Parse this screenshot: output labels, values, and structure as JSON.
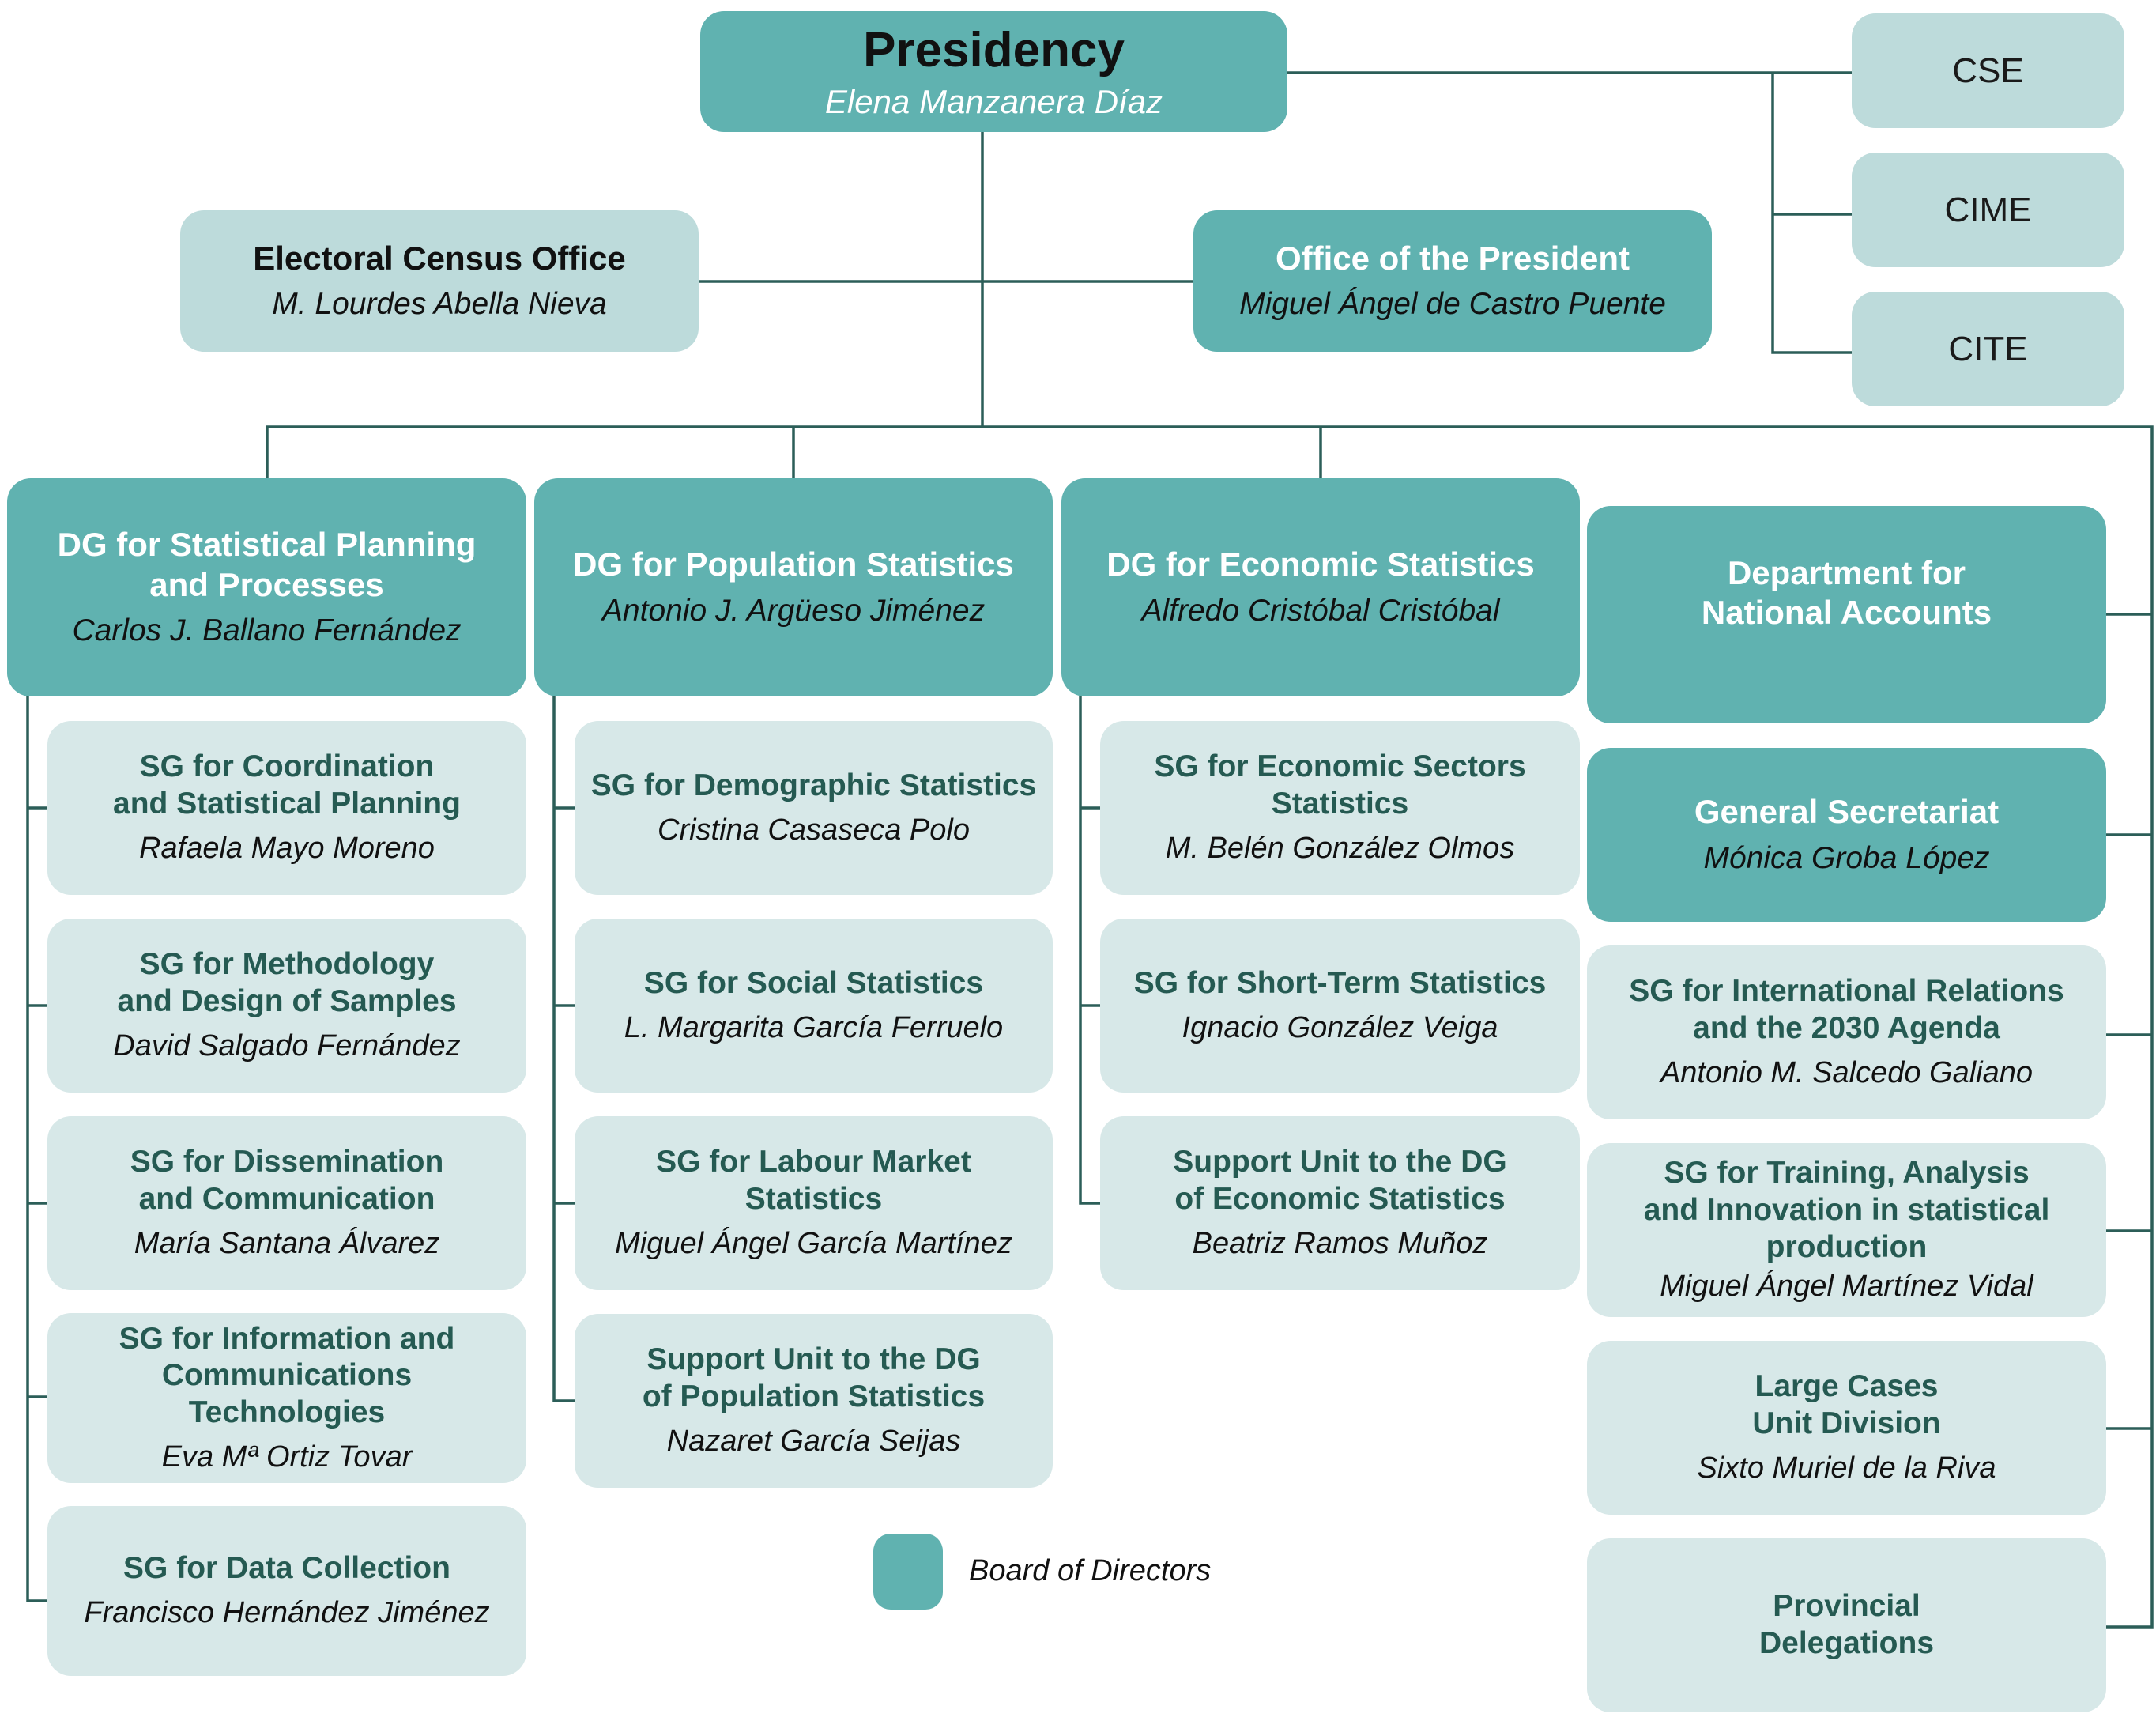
{
  "presidency": {
    "title": "Presidency",
    "name": "Elena Manzanera Díaz"
  },
  "councils": [
    {
      "label": "CSE"
    },
    {
      "label": "CIME"
    },
    {
      "label": "CITE"
    }
  ],
  "electoral_census_office": {
    "title": "Electoral Census Office",
    "name": "M. Lourdes Abella Nieva"
  },
  "office_of_president": {
    "title": "Office of the President",
    "name": "Miguel Ángel de Castro Puente"
  },
  "directorates": [
    {
      "title_lines": [
        "DG for Statistical Planning",
        "and Processes"
      ],
      "name": "Carlos J. Ballano Fernández",
      "units": [
        {
          "title_lines": [
            "SG for Coordination",
            "and Statistical Planning"
          ],
          "name": "Rafaela Mayo Moreno"
        },
        {
          "title_lines": [
            "SG for Methodology",
            "and Design of Samples"
          ],
          "name": "David Salgado Fernández"
        },
        {
          "title_lines": [
            "SG for Dissemination",
            "and Communication"
          ],
          "name": "María Santana Álvarez"
        },
        {
          "title_lines": [
            "SG for Information and",
            "Communications Technologies"
          ],
          "name": "Eva Mª Ortiz Tovar"
        },
        {
          "title_lines": [
            "SG for Data Collection"
          ],
          "name": "Francisco Hernández Jiménez"
        }
      ]
    },
    {
      "title_lines": [
        "DG for Population Statistics"
      ],
      "name": "Antonio J. Argüeso Jiménez",
      "units": [
        {
          "title_lines": [
            "SG for Demographic Statistics"
          ],
          "name": "Cristina Casaseca Polo"
        },
        {
          "title_lines": [
            "SG for Social Statistics"
          ],
          "name": "L. Margarita García Ferruelo"
        },
        {
          "title_lines": [
            "SG for Labour Market",
            "Statistics"
          ],
          "name": "Miguel Ángel García Martínez"
        },
        {
          "title_lines": [
            "Support Unit to the DG",
            "of Population Statistics"
          ],
          "name": "Nazaret García Seijas"
        }
      ]
    },
    {
      "title_lines": [
        "DG for Economic Statistics"
      ],
      "name": "Alfredo Cristóbal Cristóbal",
      "units": [
        {
          "title_lines": [
            "SG for Economic Sectors",
            "Statistics"
          ],
          "name": "M. Belén González Olmos"
        },
        {
          "title_lines": [
            "SG for Short-Term Statistics"
          ],
          "name": "Ignacio González Veiga"
        },
        {
          "title_lines": [
            "Support Unit to the DG",
            "of Economic Statistics"
          ],
          "name": "Beatriz Ramos Muñoz"
        }
      ]
    }
  ],
  "right_column": [
    {
      "title_lines": [
        "Department for",
        "National Accounts"
      ],
      "name": "",
      "board": true
    },
    {
      "title_lines": [
        "General Secretariat"
      ],
      "name": "Mónica Groba López",
      "board": true
    },
    {
      "title_lines": [
        "SG for International Relations",
        "and the 2030 Agenda"
      ],
      "name": "Antonio M. Salcedo Galiano",
      "board": false
    },
    {
      "title_lines": [
        "SG for Training, Analysis",
        "and Innovation in statistical",
        "production"
      ],
      "name": "Miguel Ángel Martínez Vidal",
      "board": false
    },
    {
      "title_lines": [
        "Large Cases",
        "Unit Division"
      ],
      "name": "Sixto Muriel de la Riva",
      "board": false
    },
    {
      "title_lines": [
        "Provincial",
        "Delegations"
      ],
      "name": "",
      "board": false
    }
  ],
  "legend": {
    "label": "Board of Directors",
    "color": "#60b2b0"
  },
  "colors": {
    "board": "#60b2b0",
    "unit": "#d7e8e8",
    "auxiliary": "#bddbdb",
    "line": "#2c5e58",
    "unit_text": "#255a52"
  }
}
